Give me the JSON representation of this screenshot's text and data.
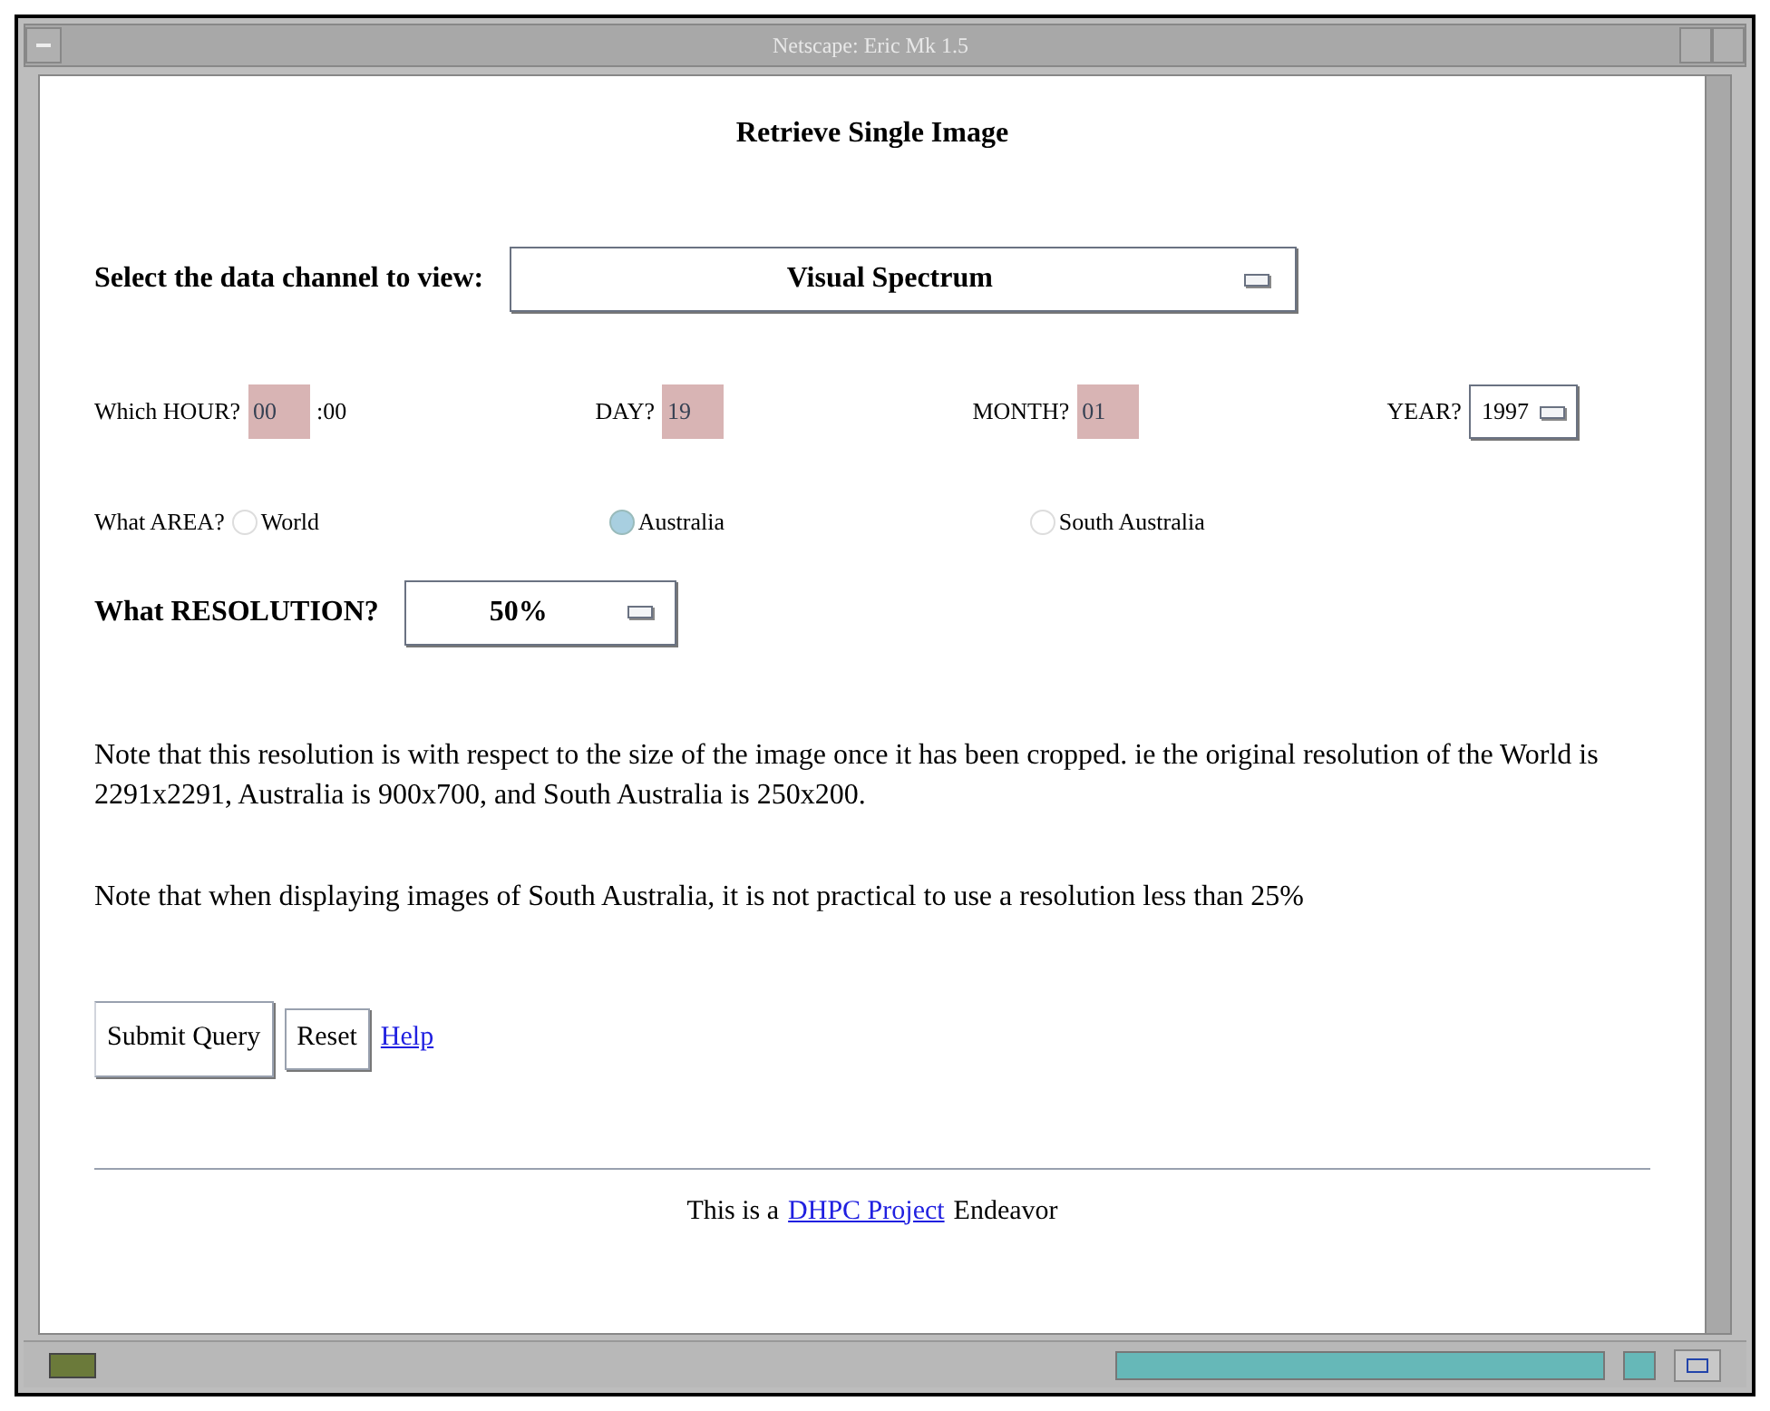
{
  "window": {
    "title": "Netscape: Eric Mk 1.5"
  },
  "heading": "Retrieve Single Image",
  "channel": {
    "label": "Select the data channel to view:",
    "value": "Visual Spectrum"
  },
  "time_fields": [
    {
      "kind": "input",
      "label": "Which HOUR?",
      "value": "00",
      "suffix": ":00"
    },
    {
      "kind": "input",
      "label": "DAY?",
      "value": "19"
    },
    {
      "kind": "input",
      "label": "MONTH?",
      "value": "01"
    },
    {
      "kind": "select",
      "label": "YEAR?",
      "value": "1997"
    }
  ],
  "area": {
    "label": "What AREA?",
    "options": [
      {
        "label": "World",
        "selected": false
      },
      {
        "label": "Australia",
        "selected": true
      },
      {
        "label": "South Australia",
        "selected": false
      }
    ]
  },
  "resolution": {
    "label": "What RESOLUTION?",
    "value": "50%"
  },
  "notes": [
    "Note that this resolution is with respect to the size of the image once it has been cropped. ie the original resolution of the World is 2291x2291, Australia is 900x700, and South Australia is 250x200.",
    "Note that when displaying images of South Australia, it is not practical to use a resolution less than 25%"
  ],
  "buttons": [
    "Submit Query",
    "Reset"
  ],
  "help_link": "Help",
  "footer": {
    "before": "This is a",
    "link": "DHPC Project",
    "after": "Endeavor"
  }
}
